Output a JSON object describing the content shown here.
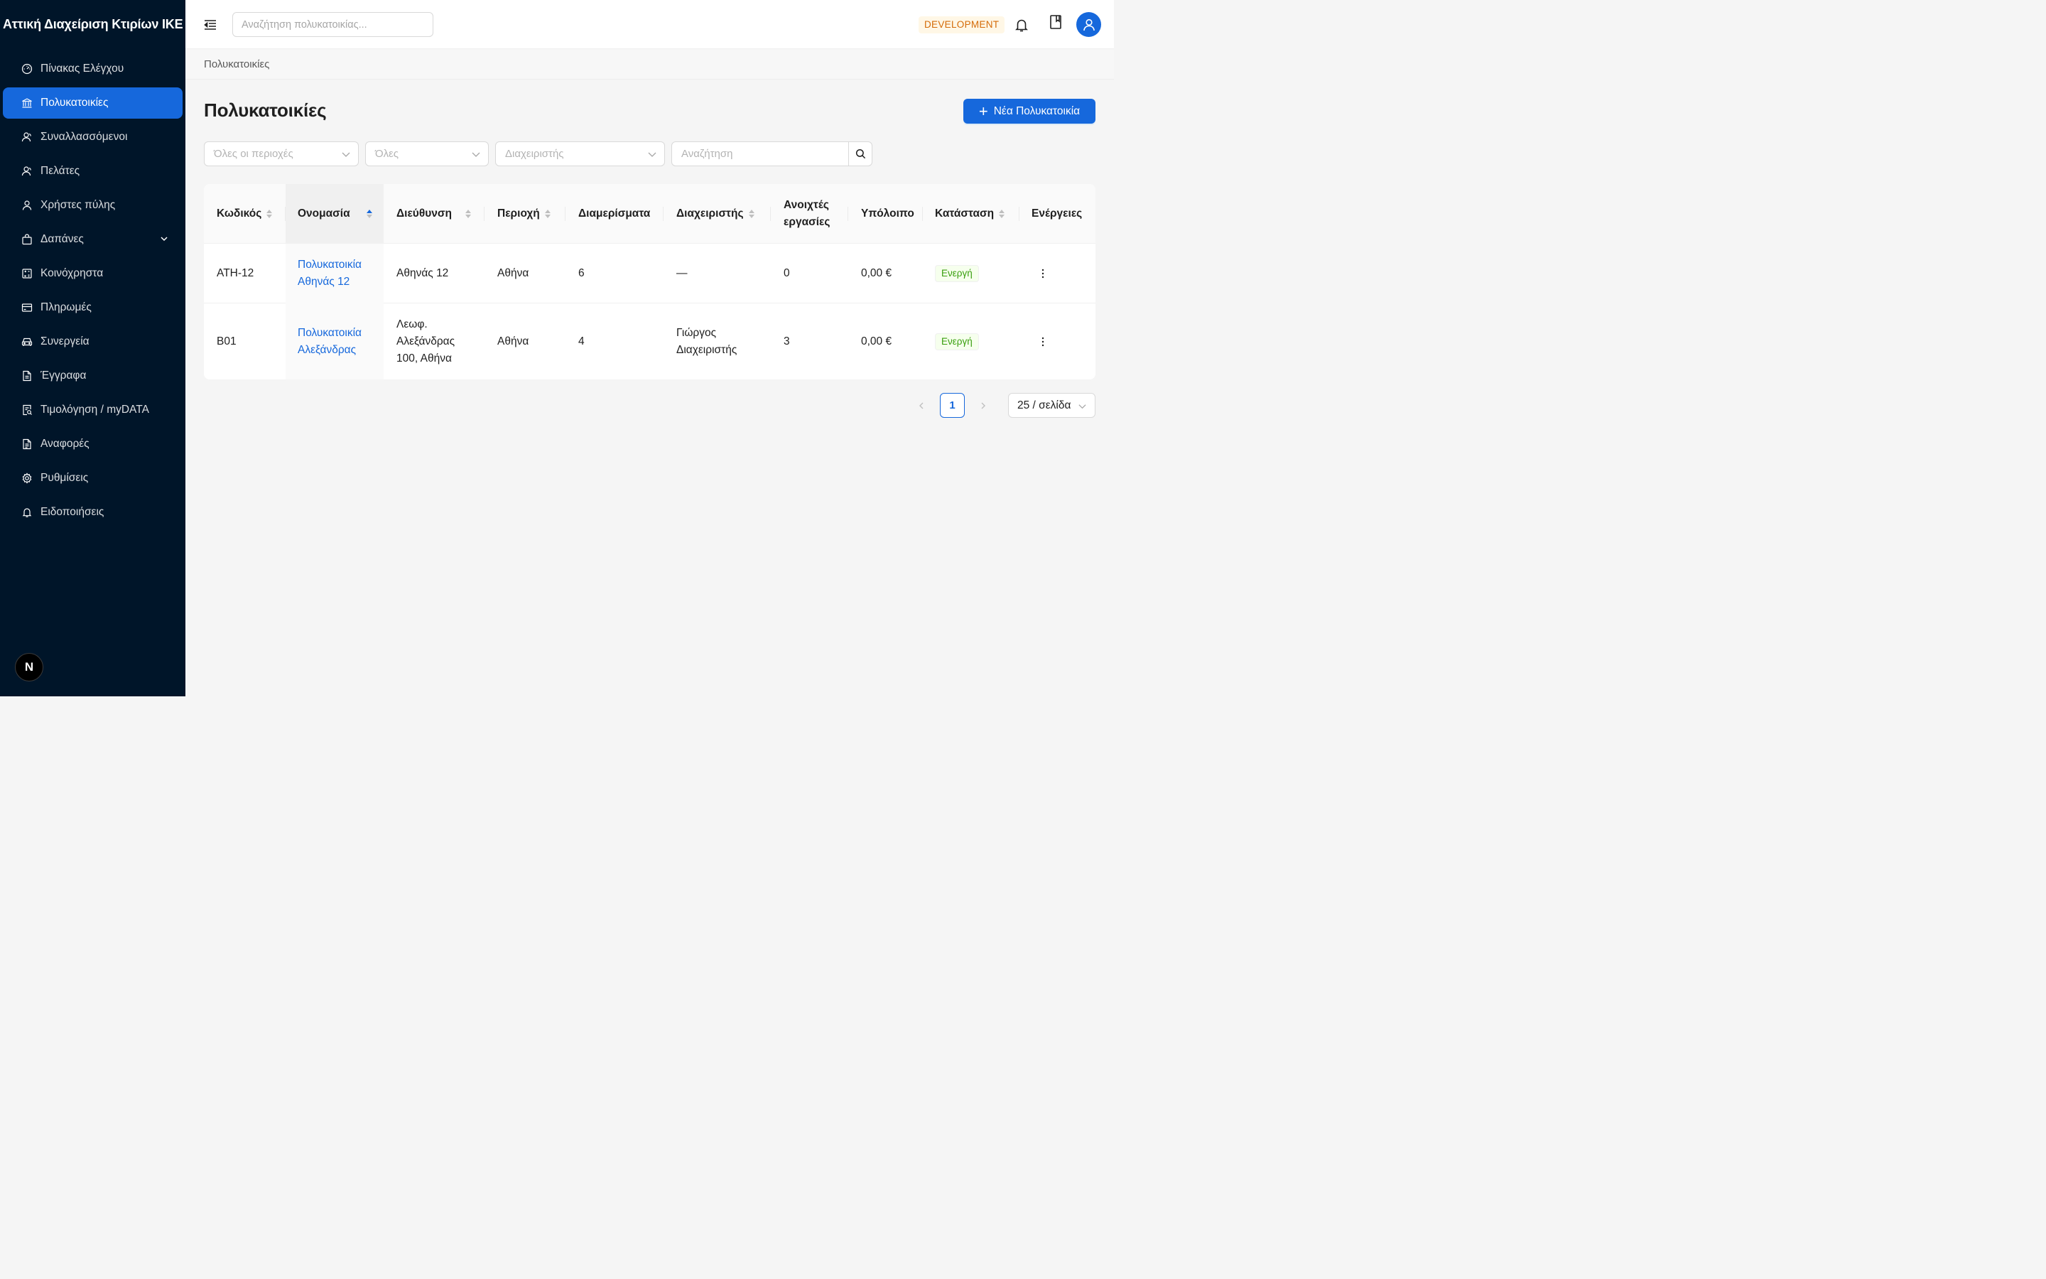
{
  "app": {
    "brand": "Αττική Διαχείριση Κτιρίων ΙΚΕ",
    "env_badge": "DEVELOPMENT",
    "logo_letter": "N"
  },
  "topbar": {
    "search_placeholder": "Αναζήτηση πολυκατοικίας..."
  },
  "sidebar": {
    "items": [
      {
        "label": "Πίνακας Ελέγχου",
        "icon": "dashboard-icon"
      },
      {
        "label": "Πολυκατοικίες",
        "icon": "bank-icon",
        "active": true
      },
      {
        "label": "Συναλλασσόμενοι",
        "icon": "contacts-icon"
      },
      {
        "label": "Πελάτες",
        "icon": "customers-icon"
      },
      {
        "label": "Χρήστες πύλης",
        "icon": "user-icon"
      },
      {
        "label": "Δαπάνες",
        "icon": "shopping-bag-icon",
        "expandable": true
      },
      {
        "label": "Κοινόχρηστα",
        "icon": "calculator-icon"
      },
      {
        "label": "Πληρωμές",
        "icon": "credit-card-icon"
      },
      {
        "label": "Συνεργεία",
        "icon": "car-icon"
      },
      {
        "label": "Έγγραφα",
        "icon": "file-icon"
      },
      {
        "label": "Τιμολόγηση / myDATA",
        "icon": "file-search-icon"
      },
      {
        "label": "Αναφορές",
        "icon": "file-text-icon"
      },
      {
        "label": "Ρυθμίσεις",
        "icon": "gear-icon"
      },
      {
        "label": "Ειδοποιήσεις",
        "icon": "bell-icon"
      }
    ]
  },
  "breadcrumb": {
    "current": "Πολυκατοικίες"
  },
  "page": {
    "title": "Πολυκατοικίες",
    "new_button": "Νέα Πολυκατοικία"
  },
  "filters": {
    "region_placeholder": "Όλες οι περιοχές",
    "status_placeholder": "Όλες",
    "manager_placeholder": "Διαχειριστής",
    "search_placeholder": "Αναζήτηση"
  },
  "table": {
    "columns": [
      {
        "label": "Κωδικός",
        "sortable": true
      },
      {
        "label": "Ονομασία",
        "sortable": true,
        "sorted": "ascend"
      },
      {
        "label": "Διεύθυνση",
        "sortable": true
      },
      {
        "label": "Περιοχή",
        "sortable": true
      },
      {
        "label": "Διαμερίσματα",
        "sortable": false
      },
      {
        "label": "Διαχειριστής",
        "sortable": true
      },
      {
        "label": "Ανοιχτές εργασίες",
        "sortable": false
      },
      {
        "label": "Υπόλοιπο",
        "sortable": false
      },
      {
        "label": "Κατάσταση",
        "sortable": true
      },
      {
        "label": "Ενέργειες",
        "sortable": false
      }
    ],
    "rows": [
      {
        "code": "ATH-12",
        "name": "Πολυκατοικία Αθηνάς 12",
        "address": "Αθηνάς 12",
        "region": "Αθήνα",
        "apartments": "6",
        "manager": "—",
        "open_tasks": "0",
        "balance": "0,00 €",
        "status": "Ενεργή"
      },
      {
        "code": "B01",
        "name": "Πολυκατοικία Αλεξάνδρας",
        "address": "Λεωφ. Αλεξάνδρας 100, Αθήνα",
        "region": "Αθήνα",
        "apartments": "4",
        "manager": "Γιώργος Διαχειριστής",
        "open_tasks": "3",
        "balance": "0,00 €",
        "status": "Ενεργή"
      }
    ]
  },
  "pagination": {
    "current_page": "1",
    "page_size": "25 / σελίδα"
  },
  "colors": {
    "primary": "#1668dc",
    "sidebar_bg": "#001529",
    "success": "#389e0d",
    "warning": "#d46b08"
  }
}
